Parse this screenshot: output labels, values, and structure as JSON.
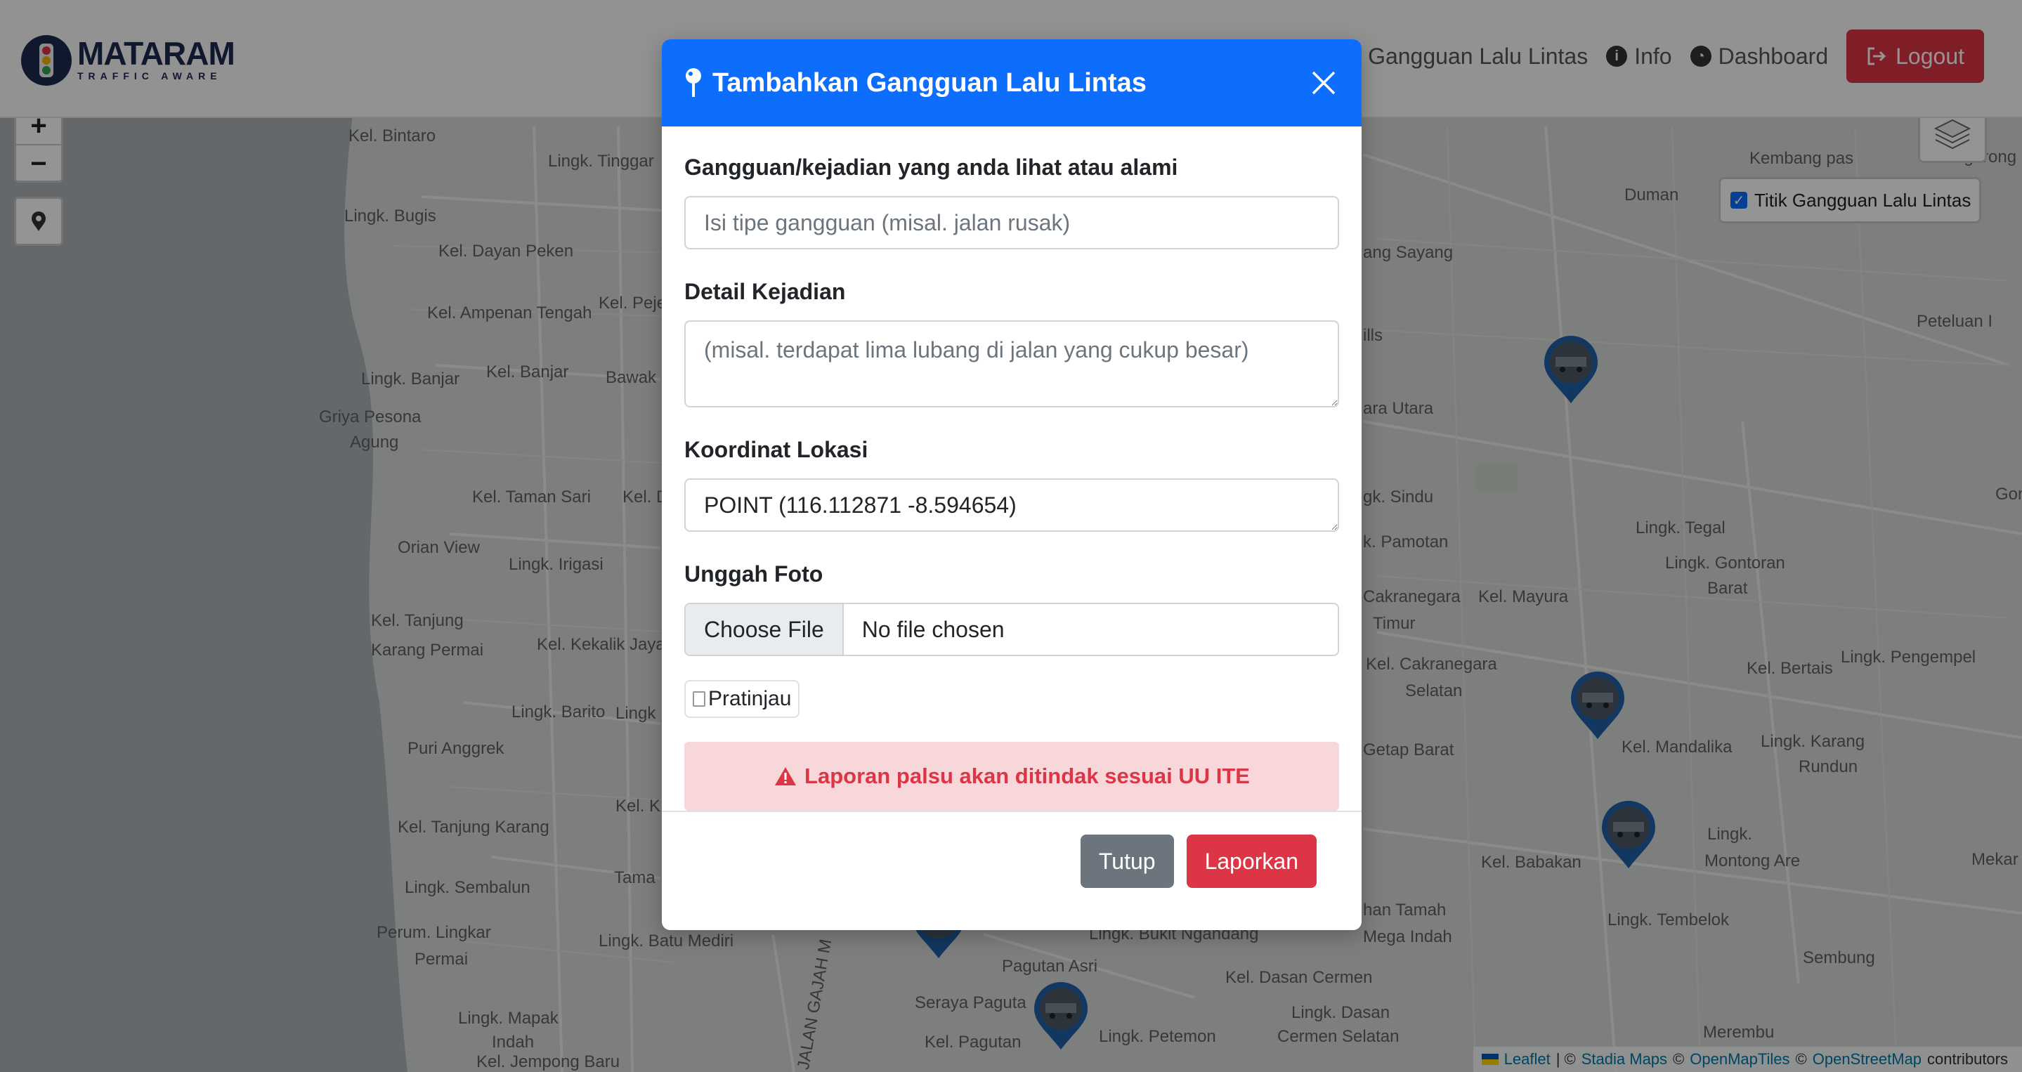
{
  "navbar": {
    "brand_title": "MATARAM",
    "brand_subtitle": "TRAFFIC AWARE",
    "links": {
      "gangguan": "Gangguan Lalu Lintas",
      "info": "Info",
      "dashboard": "Dashboard",
      "logout": "Logout"
    }
  },
  "map": {
    "layer_toggle_label": "Titik Gangguan Lalu Lintas",
    "layer_toggle_checked": true,
    "zoom_in": "+",
    "zoom_out": "−",
    "attribution": {
      "leaflet": "Leaflet",
      "sep1": "| ©",
      "stadia": "Stadia Maps",
      "sep2": "©",
      "openmaptiles": "OpenMapTiles",
      "sep3": "©",
      "osm": "OpenStreetMap",
      "suffix": "contributors"
    },
    "labels": [
      "Kel. Bintaro",
      "Lingk. Tinggar",
      "Lingk. Bugis",
      "Kel. Dayan Peken",
      "Kel. Ampenan Tengah",
      "Kel. Peje",
      "Lingk. Banjar",
      "Kel. Banjar",
      "Bawak",
      "Griya Pesona",
      "Agung",
      "Kel. Taman Sari",
      "Kel. D",
      "Orian View",
      "Lingk. Irigasi",
      "Kel. Tanjung",
      "Karang Permai",
      "Kel. Kekalik Jaya",
      "Lingk. Barito",
      "Lingk",
      "Puri Anggrek",
      "Kel. K",
      "Kel. Tanjung Karang",
      "Tama",
      "Lingk. Sembalun",
      "Perum. Lingkar",
      "Permai",
      "Lingk. Batu Mediri",
      "Lingk. Mapak",
      "Indah",
      "Kel. Jempong Baru",
      "JALAN GAJAH M",
      "Pagutan Asri",
      "Seraya Paguta",
      "Kel. Pagutan",
      "Lingk. Petemon",
      "Lingk. Bukit Ngandang",
      "Kembang pas",
      "Duman",
      "ang Sayang",
      "Peteluan I",
      "ills",
      "ara Utara",
      "gk. Sindu",
      "Gont",
      "k. Pamotan",
      "Lingk. Tegal",
      "Lingk. Gontoran",
      "Barat",
      "Cakranegara",
      "Kel. Mayura",
      "Timur",
      "Kel. Cakranegara",
      "Selatan",
      "Kel. Bertais",
      "Lingk. Pengempel",
      "Getap Barat",
      "Kel. Mandalika",
      "Lingk. Karang",
      "Rundun",
      "Kel. Babakan",
      "Lingk.",
      "Montong Are",
      "Mekar",
      "han Tamah",
      "Lingk. Tembelok",
      "Mega Indah",
      "Sembung",
      "Kel. Dasan Cermen",
      "Lingk. Dasan",
      "Cermen Selatan",
      "Merembu",
      "Sigerong"
    ]
  },
  "modal": {
    "title": "Tambahkan Gangguan Lalu Lintas",
    "fields": {
      "type_label": "Gangguan/kejadian yang anda lihat atau alami",
      "type_placeholder": "Isi tipe gangguan (misal. jalan rusak)",
      "type_value": "",
      "detail_label": "Detail Kejadian",
      "detail_placeholder": "(misal. terdapat lima lubang di jalan yang cukup besar)",
      "detail_value": "",
      "coord_label": "Koordinat Lokasi",
      "coord_value": "POINT (116.112871 -8.594654)",
      "photo_label": "Unggah Foto",
      "file_button": "Choose File",
      "file_status": "No file chosen",
      "preview_alt": "Pratinjau"
    },
    "warning": "Laporan palsu akan ditindak sesuai UU ITE",
    "buttons": {
      "close": "Tutup",
      "submit": "Laporkan"
    }
  },
  "colors": {
    "primary": "#0d6efd",
    "danger": "#dc3545",
    "secondary": "#6c757d",
    "alert_bg": "#f8d7da",
    "navy": "#1b2a4e"
  }
}
